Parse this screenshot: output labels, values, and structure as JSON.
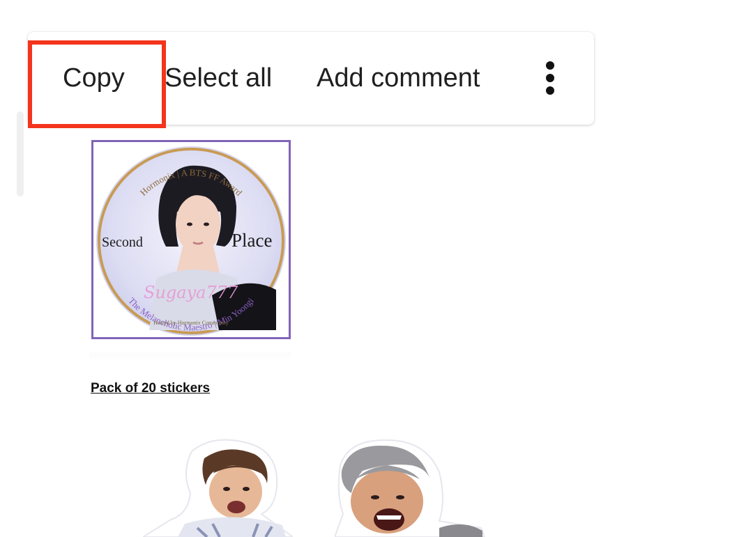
{
  "context_menu": {
    "copy_label": "Copy",
    "select_all_label": "Select all",
    "add_comment_label": "Add comment",
    "more_icon": "more-vert-icon"
  },
  "highlight": {
    "color": "#f4341d",
    "target": "Copy"
  },
  "badge": {
    "arc_text": "Hormonix | A BTS FF Award",
    "left_word": "Second",
    "right_word": "Place",
    "script_name": "Sugaya777",
    "bottom_arc": "The Melancholic Maestro | Min Yoongi",
    "bottom_small": "Hosted by Hormonix Community",
    "frame_color": "#8064b8"
  },
  "content": {
    "heading": "Pack of 20 stickers"
  }
}
